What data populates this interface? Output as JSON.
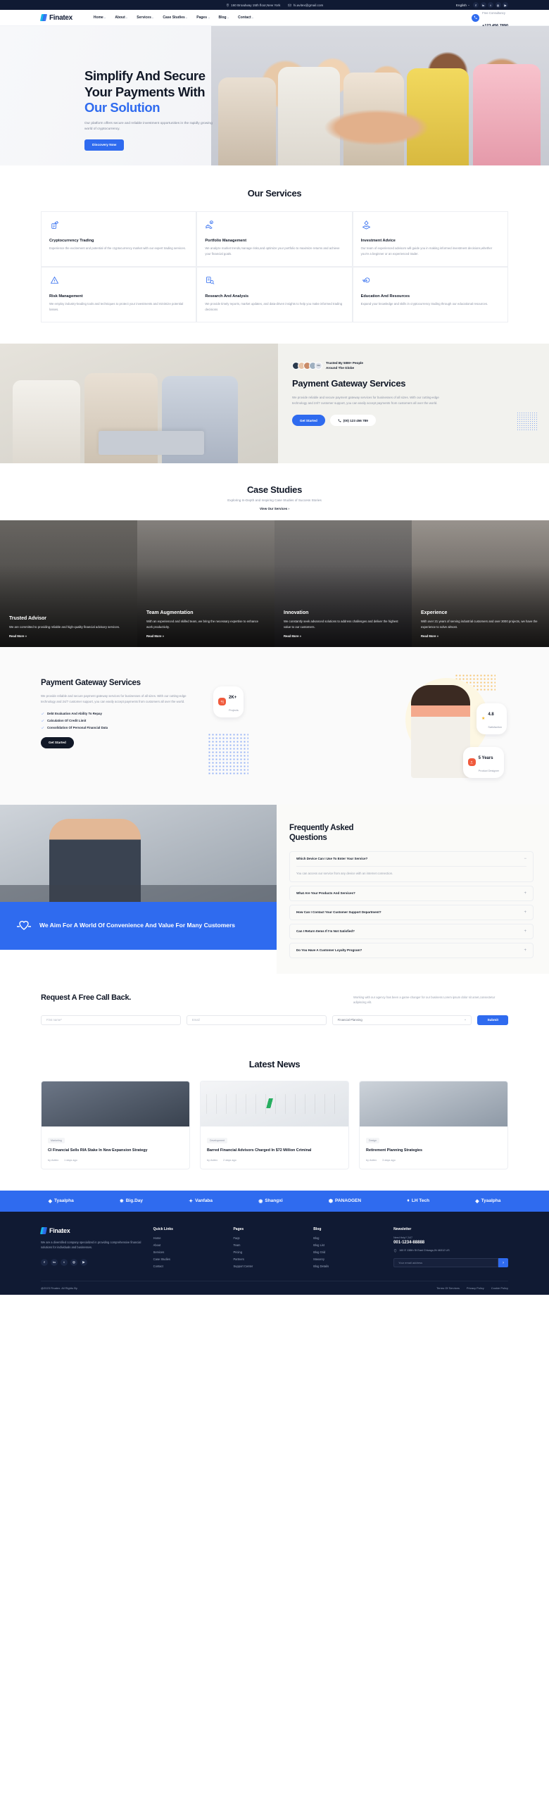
{
  "topbar": {
    "address": "160 Broadway 15th floor,New York",
    "email": "hi.avitex@gmail.com",
    "language": "English",
    "socials": [
      "facebook-icon",
      "linkedin-icon",
      "twitter-icon",
      "instagram-icon",
      "youtube-icon"
    ],
    "social_glyphs": [
      "f",
      "in",
      "t",
      "◎",
      "▶"
    ]
  },
  "header": {
    "brand": "Finatex",
    "nav": [
      "Home",
      "About",
      "Services",
      "Case Studies",
      "Pages",
      "Blog",
      "Contact"
    ],
    "consult_label": "Free Consultancy",
    "phone": "+123 456 7890"
  },
  "hero": {
    "title_line1": "Simplify And Secure",
    "title_line2": "Your Payments With",
    "title_line3": "Our Solution",
    "desc": "Our platform offers secure and reliable investment opportunities in the rapidly growing world of cryptocurrency.",
    "cta": "Discovery Now"
  },
  "services": {
    "title": "Our Services",
    "cards": [
      {
        "icon": "crypto-trading-icon",
        "title": "Cryptocurrency Trading",
        "desc": "Experience the excitement and potential of the cryptocurrency market with our expert trading services."
      },
      {
        "icon": "portfolio-management-icon",
        "title": "Portfolio Management",
        "desc": "We analyze market trends,manage risks,and optimize your portfolio to maximize returns and achieve your financial goals."
      },
      {
        "icon": "investment-advice-icon",
        "title": "Investment Advice",
        "desc": "Our team of experienced advisors will guide you in making informed investment decisions,whether you're a beginner or an experienced trader."
      },
      {
        "icon": "risk-management-icon",
        "title": "Risk Management",
        "desc": "We employ industry-leading tools and techniques to protect your investments and minimize potential losses."
      },
      {
        "icon": "research-analysis-icon",
        "title": "Research And Analysis",
        "desc": "We provide timely reports, market updates, and data-driven insights to help you make informed trading decisions"
      },
      {
        "icon": "education-resources-icon",
        "title": "Education And Resources",
        "desc": "Expand your knowledge and skills in cryptocurrency trading through our educational resources."
      }
    ]
  },
  "gateway1": {
    "trusted_line1": "Trusted By 50M+ People",
    "trusted_line2": "Around The Globe",
    "avatar_count_label": "5M",
    "title": "Payment Gateway Services",
    "desc": "We provide reliable and secure payment gateway services for businesses of all sizes. With our cutting-edge technology and 24/7 customer support, you can easily accept payments from customers all over the world.",
    "cta": "Get Started",
    "phone": "(00) 123 456 789"
  },
  "cases": {
    "title": "Case Studies",
    "subtitle": "Exploring In-Depth and Inspiring Case Studies of Success Stories",
    "view_link": "View Our Services",
    "read_more": "Read More",
    "items": [
      {
        "title": "Trusted Advisor",
        "desc": "We are committed to providing reliable and high-quality financial advisory services."
      },
      {
        "title": "Team Augmentation",
        "desc": "With an experienced and skilled team, we bring the necessary expertise to enhance work productivity."
      },
      {
        "title": "Innovation",
        "desc": "We constantly seek advanced solutions to address challenges and deliver the highest value to our customers."
      },
      {
        "title": "Experience",
        "desc": "With over 21 years of serving industrial customers and over 3000 projects, we have the experience to solve almost."
      }
    ]
  },
  "gateway2": {
    "title": "Payment Gateway Services",
    "desc": "We provide reliable and secure payment gateway services for businesses of all sizes. With our cutting-edge technology and 24/7 customer support, you can easily accept payments from customers all over the world.",
    "checks": [
      "Debt Evaluation And Ability To Repay",
      "Calculation Of Credit Limit",
      "Consolidation Of Personal Financial Data"
    ],
    "cta": "Get Started",
    "badge_projects_value": "2K+",
    "badge_projects_label": "Projects",
    "badge_rating_value": "4.8",
    "badge_rating_label": "Satisfaction",
    "badge_years_value": "5 Years",
    "badge_years_label": "Product Designer"
  },
  "faq": {
    "title_line1": "Frequently Asked",
    "title_line2": "Questions",
    "banner": "We Aim For A World Of Convenience And Value For Many Customers",
    "items": [
      {
        "q": "Which Device Can I Use To Enter Your Service?",
        "a": "You can access our service from any device with an internet connection.",
        "open": true,
        "sign": "−"
      },
      {
        "q": "What Are Your Products And Services?",
        "a": "",
        "open": false,
        "sign": "+"
      },
      {
        "q": "How Can I Contact Your Customer Support Department?",
        "a": "",
        "open": false,
        "sign": "+"
      },
      {
        "q": "Can I Return Items If I'm Not Satisfied?",
        "a": "",
        "open": false,
        "sign": "+"
      },
      {
        "q": "Do You Have A Customer Loyalty Program?",
        "a": "",
        "open": false,
        "sign": "+"
      }
    ]
  },
  "callback": {
    "title": "Request A Free Call Back.",
    "desc": "Working with our agency has been a game-changer for our business Lorem ipsum dolor sit amet,consectetur adipiscing elit.",
    "first_name_placeholder": "First name*",
    "email_placeholder": "Email",
    "select_value": "Financial Planning",
    "submit": "Submit"
  },
  "news": {
    "title": "Latest News",
    "items": [
      {
        "tag": "Marketing",
        "title": "CI Financial Sells RIA Stake In New Expansion Strategy",
        "author": "by Avitex",
        "date": "1 days ago"
      },
      {
        "tag": "Development",
        "title": "Barred Financial Advisors Charged In $72 Million Criminal",
        "author": "by Avitex",
        "date": "2 days ago"
      },
      {
        "tag": "Design",
        "title": "Retirement Planning Strategies",
        "author": "by Avitex",
        "date": "3 days ago"
      }
    ]
  },
  "brands": [
    "Tyaalpha",
    "Big.Day",
    "Vanfaba",
    "Shangxi",
    "PANAOGEN",
    "LH Tech",
    "Tyaalpha"
  ],
  "footer": {
    "brand": "Finatex",
    "about": "We are a diversified company specialized in providing comprehensive financial solutions for individuals and businesses.",
    "col_quick_title": "Quick Links",
    "col_quick": [
      "Home",
      "About",
      "Services",
      "Case Studies",
      "Contact"
    ],
    "col_pages_title": "Pages",
    "col_pages": [
      "Faqs",
      "Team",
      "Pricing",
      "Partners",
      "Support Center"
    ],
    "col_blog_title": "Blog",
    "col_blog": [
      "Blog",
      "Blog List",
      "Blog Grid",
      "Masonry",
      "Blog Details"
    ],
    "newsletter_title": "Newsletter",
    "need_help": "Need Help? 24/7",
    "phone": "001-1234-88888",
    "address": "160 E 138th St East Chicago,IN 46312 US",
    "email_placeholder": "Your email address",
    "socials": [
      "f",
      "in",
      "t",
      "◎",
      "▶"
    ],
    "copyright": "@2023 Finatex. All Rights By",
    "links": [
      "Terms Of Services",
      "Privacy Policy",
      "Cookie Policy"
    ]
  }
}
